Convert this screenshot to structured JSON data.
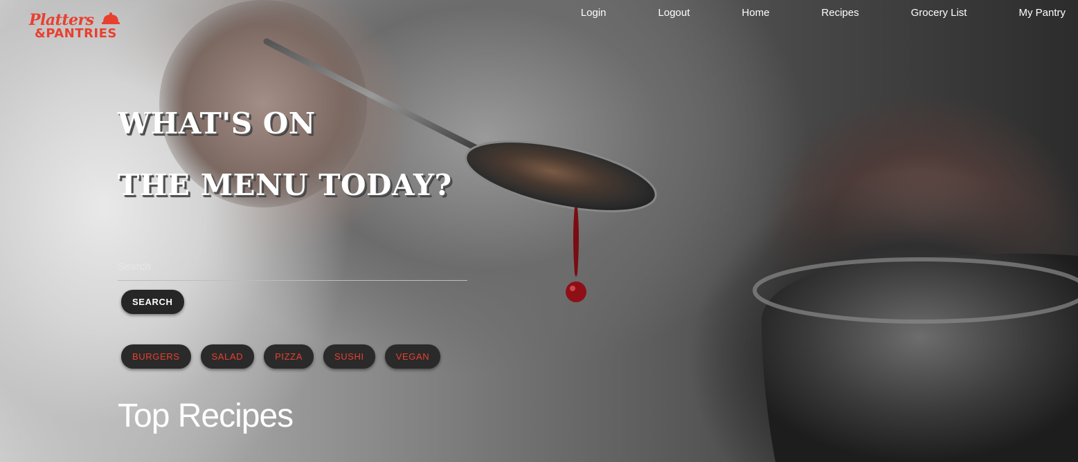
{
  "brand": {
    "line1": "Platters",
    "line2": "&PANTRIES",
    "color": "#e8402f"
  },
  "nav": {
    "items": [
      {
        "label": "Login"
      },
      {
        "label": "Logout"
      },
      {
        "label": "Home"
      },
      {
        "label": "Recipes"
      },
      {
        "label": "Grocery List"
      },
      {
        "label": "My Pantry"
      }
    ]
  },
  "hero": {
    "headline_line1": "WHAT'S ON",
    "headline_line2": "THE MENU TODAY?"
  },
  "search": {
    "placeholder": "Search",
    "value": "",
    "button_label": "SEARCH"
  },
  "categories": [
    {
      "label": "BURGERS"
    },
    {
      "label": "SALAD"
    },
    {
      "label": "PIZZA"
    },
    {
      "label": "SUSHI"
    },
    {
      "label": "VEGAN"
    }
  ],
  "section": {
    "title": "Top Recipes"
  },
  "colors": {
    "accent": "#e8402f",
    "button_bg": "#262626"
  }
}
